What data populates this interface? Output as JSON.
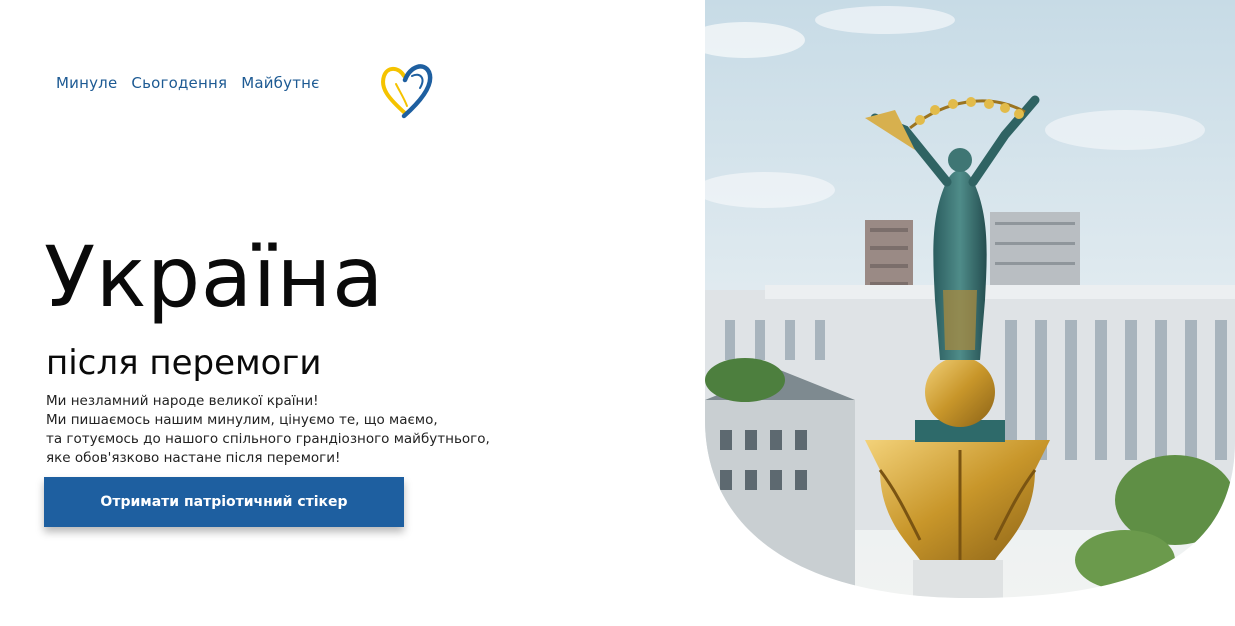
{
  "nav": {
    "items": [
      {
        "label": "Минуле"
      },
      {
        "label": "Сьогодення"
      },
      {
        "label": "Майбутнє"
      }
    ]
  },
  "logo": {
    "icon": "heart-logo-icon",
    "colors": [
      "#f5c300",
      "#1e5fa0"
    ]
  },
  "hero": {
    "title": "Україна",
    "subtitle": "після перемоги",
    "lead_lines": [
      "Ми незламний народе великої країни!",
      "Ми пишаємось нашим минулим, цінуємо те, що маємо,",
      "та готуємось до нашого спільного грандіозного майбутнього,",
      "яке обов'язково настане після перемоги!"
    ],
    "cta_label": "Отримати патріотичний стікер"
  },
  "image": {
    "subject": "independence-monument-photo"
  },
  "colors": {
    "accent": "#1e5fa0",
    "nav_text": "#1d5a93",
    "yellow": "#f5c300"
  }
}
